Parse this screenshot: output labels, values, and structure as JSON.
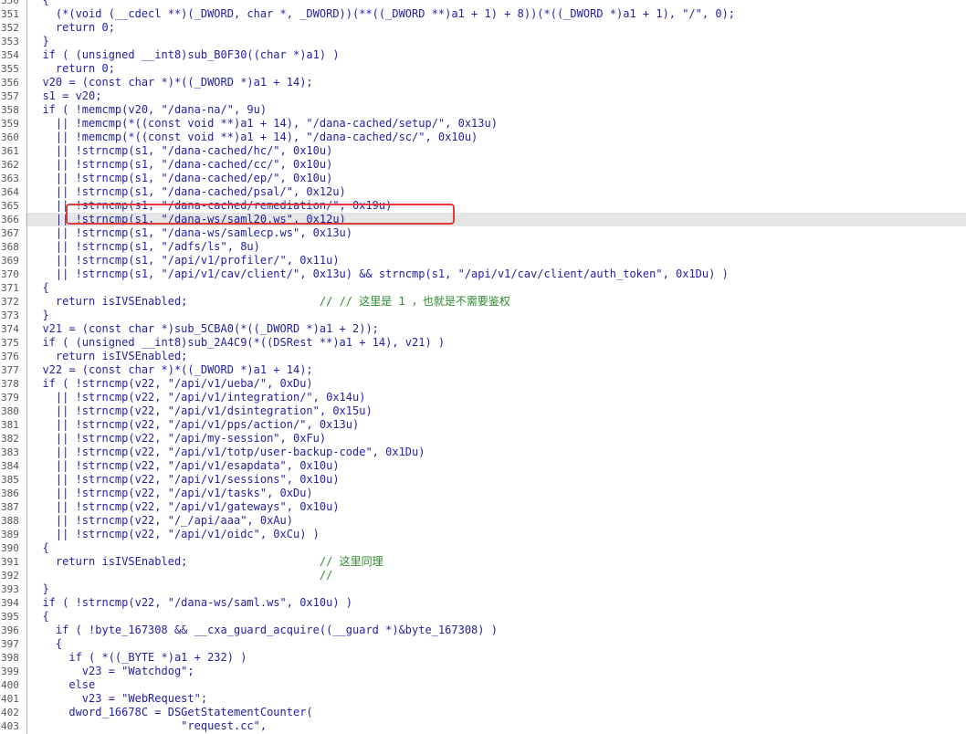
{
  "editor": {
    "current_line": 366,
    "lines": [
      {
        "num": "350",
        "code": "  {"
      },
      {
        "num": "351",
        "code": "    (*(void (__cdecl **)(_DWORD, char *, _DWORD))(**((_DWORD **)a1 + 1) + 8))(*((_DWORD *)a1 + 1), \"/\", 0);"
      },
      {
        "num": "352",
        "code": "    return 0;"
      },
      {
        "num": "353",
        "code": "  }"
      },
      {
        "num": "354",
        "code": "  if ( (unsigned __int8)sub_B0F30((char *)a1) )"
      },
      {
        "num": "355",
        "code": "    return 0;"
      },
      {
        "num": "356",
        "code": "  v20 = (const char *)*((_DWORD *)a1 + 14);"
      },
      {
        "num": "357",
        "code": "  s1 = v20;"
      },
      {
        "num": "358",
        "code": "  if ( !memcmp(v20, \"/dana-na/\", 9u)"
      },
      {
        "num": "359",
        "code": "    || !memcmp(*((const void **)a1 + 14), \"/dana-cached/setup/\", 0x13u)"
      },
      {
        "num": "360",
        "code": "    || !memcmp(*((const void **)a1 + 14), \"/dana-cached/sc/\", 0x10u)"
      },
      {
        "num": "361",
        "code": "    || !strncmp(s1, \"/dana-cached/hc/\", 0x10u)"
      },
      {
        "num": "362",
        "code": "    || !strncmp(s1, \"/dana-cached/cc/\", 0x10u)"
      },
      {
        "num": "363",
        "code": "    || !strncmp(s1, \"/dana-cached/ep/\", 0x10u)"
      },
      {
        "num": "364",
        "code": "    || !strncmp(s1, \"/dana-cached/psal/\", 0x12u)"
      },
      {
        "num": "365",
        "code": "    || !strncmp(s1, \"/dana-cached/remediation/\", 0x19u)"
      },
      {
        "num": "366",
        "code": "    || !strncmp(s1, \"/dana-ws/saml20.ws\", 0x12u)"
      },
      {
        "num": "367",
        "code": "    || !strncmp(s1, \"/dana-ws/samlecp.ws\", 0x13u)"
      },
      {
        "num": "368",
        "code": "    || !strncmp(s1, \"/adfs/ls\", 8u)"
      },
      {
        "num": "369",
        "code": "    || !strncmp(s1, \"/api/v1/profiler/\", 0x11u)"
      },
      {
        "num": "370",
        "code": "    || !strncmp(s1, \"/api/v1/cav/client/\", 0x13u) && strncmp(s1, \"/api/v1/cav/client/auth_token\", 0x1Du) )"
      },
      {
        "num": "371",
        "code": "  {"
      },
      {
        "num": "372",
        "code": "    return isIVSEnabled;                    // // 这里是 1 ，也就是不需要鉴权"
      },
      {
        "num": "373",
        "code": "  }"
      },
      {
        "num": "374",
        "code": "  v21 = (const char *)sub_5CBA0(*((_DWORD *)a1 + 2));"
      },
      {
        "num": "375",
        "code": "  if ( (unsigned __int8)sub_2A4C9(*((DSRest **)a1 + 14), v21) )"
      },
      {
        "num": "376",
        "code": "    return isIVSEnabled;"
      },
      {
        "num": "377",
        "code": "  v22 = (const char *)*((_DWORD *)a1 + 14);"
      },
      {
        "num": "378",
        "code": "  if ( !strncmp(v22, \"/api/v1/ueba/\", 0xDu)"
      },
      {
        "num": "379",
        "code": "    || !strncmp(v22, \"/api/v1/integration/\", 0x14u)"
      },
      {
        "num": "380",
        "code": "    || !strncmp(v22, \"/api/v1/dsintegration\", 0x15u)"
      },
      {
        "num": "381",
        "code": "    || !strncmp(v22, \"/api/v1/pps/action/\", 0x13u)"
      },
      {
        "num": "382",
        "code": "    || !strncmp(v22, \"/api/my-session\", 0xFu)"
      },
      {
        "num": "383",
        "code": "    || !strncmp(v22, \"/api/v1/totp/user-backup-code\", 0x1Du)"
      },
      {
        "num": "384",
        "code": "    || !strncmp(v22, \"/api/v1/esapdata\", 0x10u)"
      },
      {
        "num": "385",
        "code": "    || !strncmp(v22, \"/api/v1/sessions\", 0x10u)"
      },
      {
        "num": "386",
        "code": "    || !strncmp(v22, \"/api/v1/tasks\", 0xDu)"
      },
      {
        "num": "387",
        "code": "    || !strncmp(v22, \"/api/v1/gateways\", 0x10u)"
      },
      {
        "num": "388",
        "code": "    || !strncmp(v22, \"/_/api/aaa\", 0xAu)"
      },
      {
        "num": "389",
        "code": "    || !strncmp(v22, \"/api/v1/oidc\", 0xCu) )"
      },
      {
        "num": "390",
        "code": "  {"
      },
      {
        "num": "391",
        "code": "    return isIVSEnabled;                    // 这里同理"
      },
      {
        "num": "392",
        "code": "                                            //"
      },
      {
        "num": "393",
        "code": "  }"
      },
      {
        "num": "394",
        "code": "  if ( !strncmp(v22, \"/dana-ws/saml.ws\", 0x10u) )"
      },
      {
        "num": "395",
        "code": "  {"
      },
      {
        "num": "396",
        "code": "    if ( !byte_167308 && __cxa_guard_acquire((__guard *)&byte_167308) )"
      },
      {
        "num": "397",
        "code": "    {"
      },
      {
        "num": "398",
        "code": "      if ( *((_BYTE *)a1 + 232) )"
      },
      {
        "num": "399",
        "code": "        v23 = \"Watchdog\";"
      },
      {
        "num": "400",
        "code": "      else"
      },
      {
        "num": "401",
        "code": "        v23 = \"WebRequest\";"
      },
      {
        "num": "402",
        "code": "      dword_16678C = DSGetStatementCounter("
      },
      {
        "num": "403",
        "code": "                       \"request.cc\","
      }
    ]
  }
}
